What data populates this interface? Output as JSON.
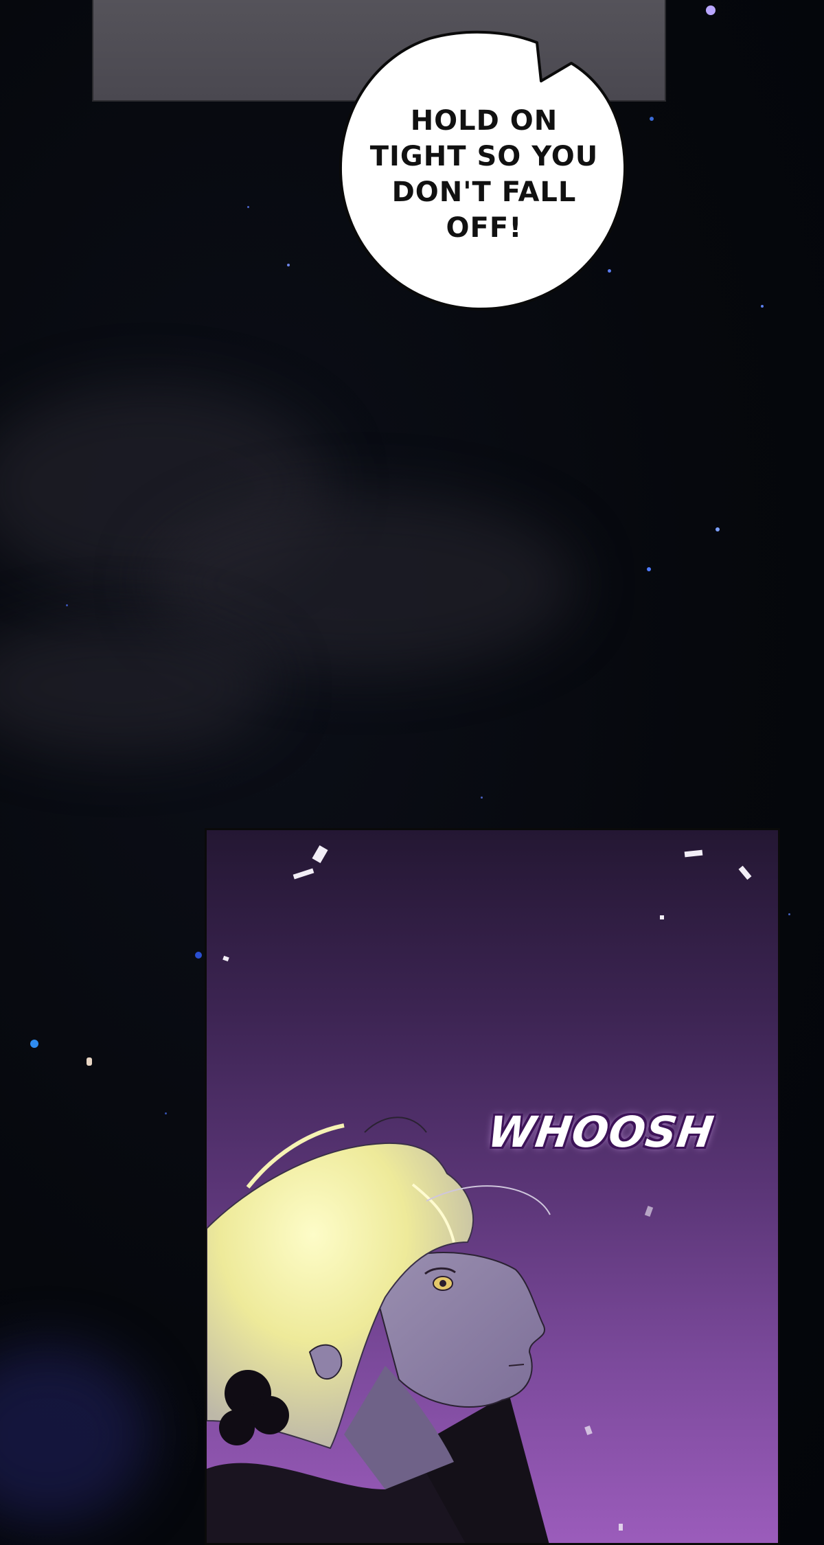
{
  "speech_bubble": {
    "lines": [
      "HOLD ON",
      "TIGHT SO YOU",
      "DON'T FALL",
      "OFF!"
    ]
  },
  "sound_effect": {
    "text": "WHOOSH"
  },
  "colors": {
    "night_sky": "#05070c",
    "panel_purple_top": "#241733",
    "panel_purple_bottom": "#9b5cbb",
    "hair_glow": "#f4f0a0",
    "bubble_fill": "#ffffff"
  }
}
